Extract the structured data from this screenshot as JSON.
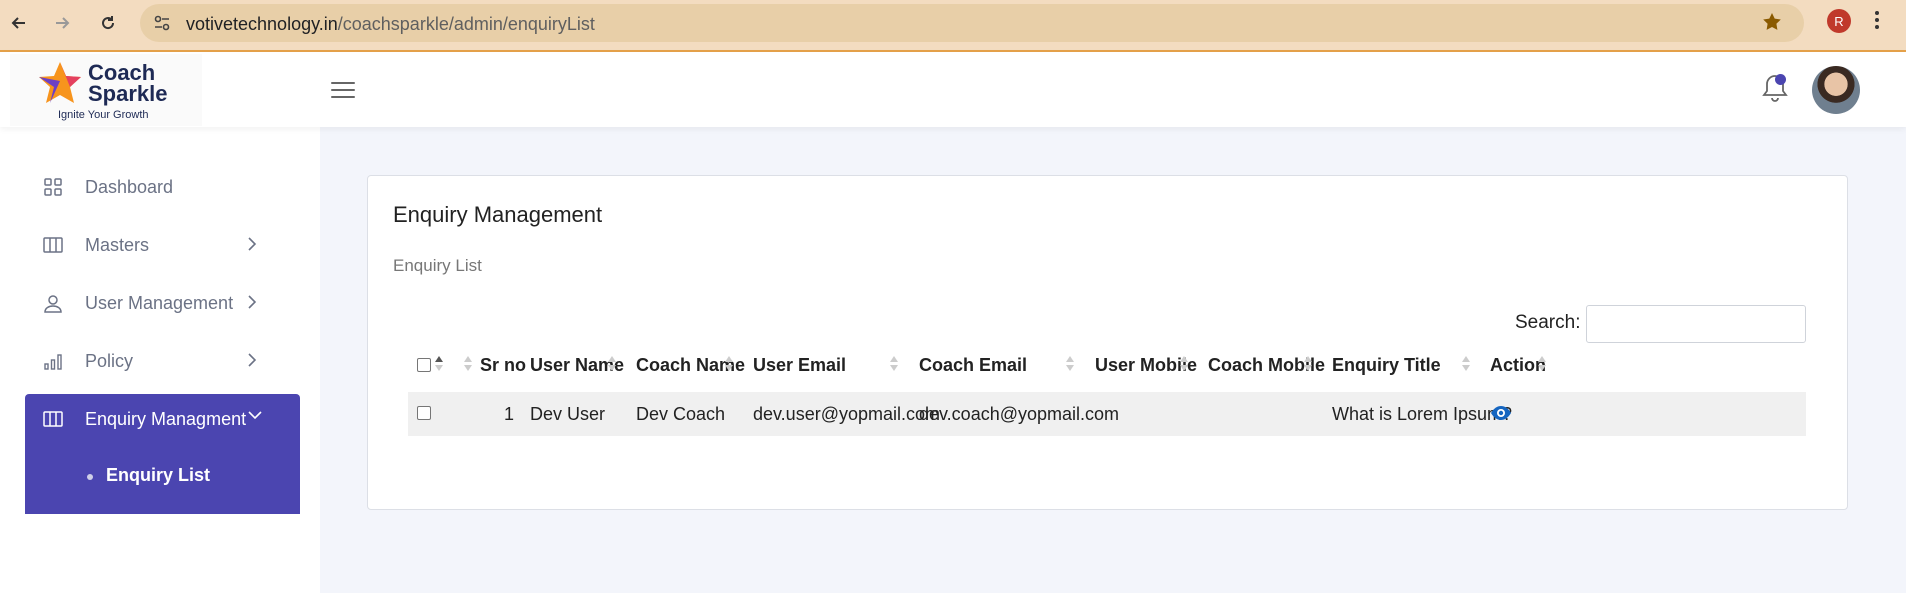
{
  "browser": {
    "url_host": "votivetechnology.in",
    "url_path": "/coachsparkle/admin/enquiryList",
    "profile_initial": "R"
  },
  "header": {
    "logo_line1": "Coach",
    "logo_line2": "Sparkle",
    "logo_tagline": "Ignite Your Growth"
  },
  "sidebar": {
    "items": [
      {
        "label": "Dashboard"
      },
      {
        "label": "Masters"
      },
      {
        "label": "User Management"
      },
      {
        "label": "Policy"
      },
      {
        "label": "Enquiry Managment"
      }
    ],
    "sub_items": [
      {
        "label": "Enquiry List"
      }
    ],
    "active_color": "#4b45b0"
  },
  "main": {
    "title": "Enquiry Management",
    "subtitle": "Enquiry List",
    "search_label": "Search:",
    "search_value": "",
    "table": {
      "columns": [
        "Sr no",
        "User Name",
        "Coach Name",
        "User Email",
        "Coach Email",
        "User Mobile",
        "Coach Mobile",
        "Enquiry Title",
        "Action"
      ],
      "rows": [
        {
          "sr_no": "1",
          "user_name": "Dev User",
          "coach_name": "Dev Coach",
          "user_email": "dev.user@yopmail.com",
          "coach_email": "dev.coach@yopmail.com",
          "user_mobile": "",
          "coach_mobile": "",
          "enquiry_title": "What is Lorem Ipsum?",
          "action_icon": "eye-icon"
        }
      ]
    }
  },
  "colors": {
    "browser_bar": "#f3dcc0",
    "accent": "#4b45b0",
    "eye_icon": "#1565c0"
  }
}
